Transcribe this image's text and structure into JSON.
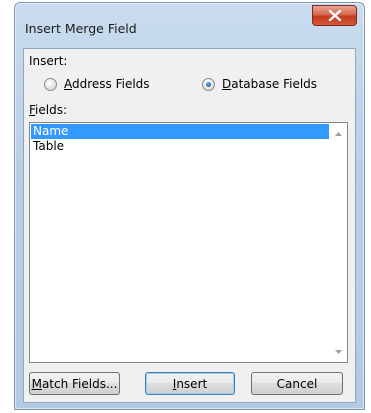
{
  "dialog": {
    "title": "Insert Merge Field",
    "close_icon": "close-icon"
  },
  "insert_group": {
    "label": "Insert:",
    "options": [
      {
        "label_accel": "A",
        "label_rest": "ddress Fields",
        "selected": false
      },
      {
        "label_accel": "D",
        "label_rest": "atabase Fields",
        "selected": true
      }
    ]
  },
  "fields": {
    "label_accel": "F",
    "label_rest": "ields:",
    "items": [
      "Name",
      "Table"
    ],
    "selected_index": 0
  },
  "buttons": {
    "match_fields": {
      "accel": "M",
      "rest": "atch Fields..."
    },
    "insert": {
      "accel": "I",
      "rest": "nsert"
    },
    "cancel": {
      "label": "Cancel"
    }
  },
  "colors": {
    "selection": "#3399ff",
    "close_button": "#c33a1c"
  }
}
